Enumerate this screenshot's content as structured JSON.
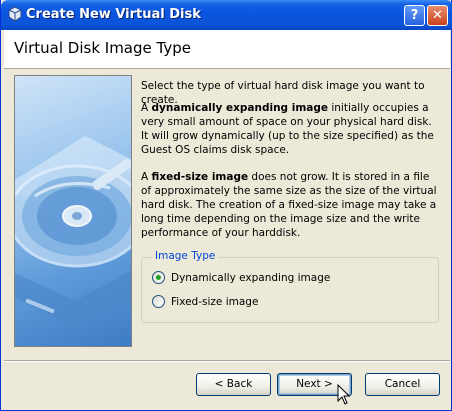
{
  "window": {
    "title": "Create New Virtual Disk",
    "help_glyph": "?",
    "close_glyph": "✕"
  },
  "header": {
    "heading": "Virtual Disk Image Type"
  },
  "content": {
    "intro": "Select the type of virtual hard disk image you want to create.",
    "dynamic_bold": "dynamically expanding image",
    "dynamic_prefix": "A ",
    "dynamic_rest": " initially occupies a very small amount of space on your physical hard disk. It will grow dynamically (up to the size specified) as the Guest OS claims disk space.",
    "fixed_prefix": "A ",
    "fixed_bold": "fixed-size image",
    "fixed_rest": " does not grow. It is stored in a file of approximately the same size as the size of the virtual hard disk. The creation of a fixed-size image may take a long time depending on the image size and the write performance of your harddisk."
  },
  "image_type": {
    "legend": "Image Type",
    "options": [
      {
        "label": "Dynamically expanding image",
        "checked": true
      },
      {
        "label": "Fixed-size image",
        "checked": false
      }
    ]
  },
  "buttons": {
    "back": "< Back",
    "next": "Next >",
    "cancel": "Cancel"
  },
  "colors": {
    "title_bar": "#0a54e0",
    "accent_blue": "#0046d5",
    "radio_checked": "#21a121"
  }
}
